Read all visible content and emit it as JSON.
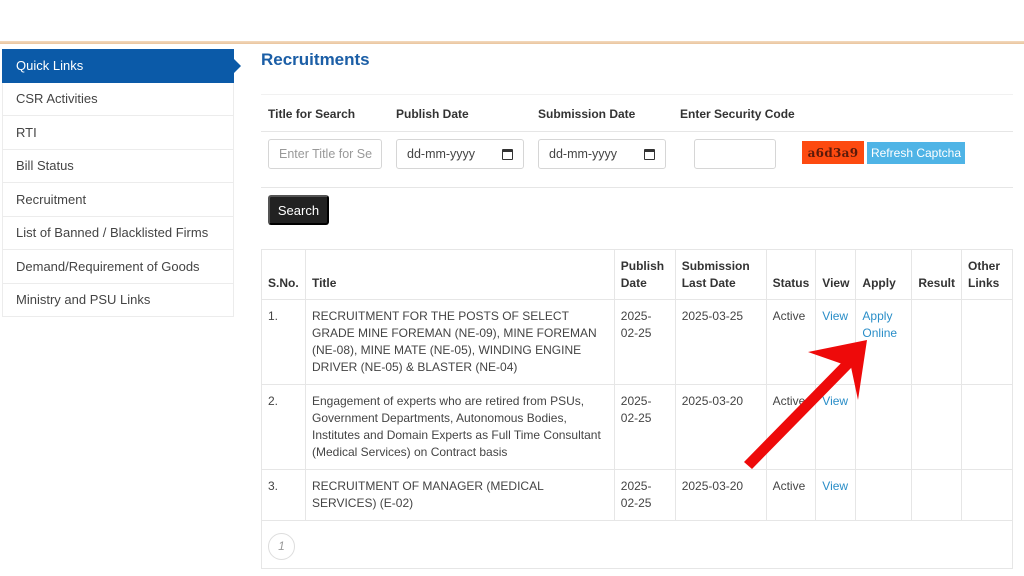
{
  "sidebar": {
    "items": [
      {
        "label": "Quick Links",
        "active": true
      },
      {
        "label": "CSR Activities"
      },
      {
        "label": "RTI"
      },
      {
        "label": "Bill Status"
      },
      {
        "label": "Recruitment"
      },
      {
        "label": "List of Banned / Blacklisted Firms"
      },
      {
        "label": "Demand/Requirement of Goods"
      },
      {
        "label": "Ministry and PSU Links"
      }
    ]
  },
  "page": {
    "title": "Recruitments"
  },
  "search_form": {
    "labels": {
      "title": "Title for Search",
      "publish_date": "Publish Date",
      "submission_date": "Submission Date",
      "security_code": "Enter Security Code"
    },
    "title_placeholder": "Enter Title for Se",
    "title_value": "",
    "publish_date_value": "dd-mm-yyyy",
    "submission_date_value": "dd-mm-yyyy",
    "security_code_value": "",
    "captcha_text": "a6d3a9",
    "refresh_label": "Refresh Captcha",
    "search_label": "Search",
    "colors": {
      "captcha_bg": "#fd4a10",
      "refresh_bg": "#4fb4e6",
      "search_bg": "#222222"
    }
  },
  "table": {
    "headers": {
      "sno": "S.No.",
      "title": "Title",
      "publish_1": "Publish",
      "publish_2": "Date",
      "submission_1": "Submission",
      "submission_2": "Last Date",
      "status": "Status",
      "view": "View",
      "apply": "Apply",
      "result": "Result",
      "other_1": "Other",
      "other_2": "Links"
    },
    "rows": [
      {
        "sno": "1.",
        "title": "RECRUITMENT FOR THE POSTS OF SELECT GRADE MINE FOREMAN (NE-09), MINE FOREMAN (NE-08), MINE MATE (NE-05), WINDING ENGINE DRIVER (NE-05) & BLASTER (NE-04)",
        "publish_1": "2025-",
        "publish_2": "02-25",
        "submission": "2025-03-25",
        "status": "Active",
        "view": "View",
        "apply_1": "Apply",
        "apply_2": "Online",
        "result": "",
        "other": ""
      },
      {
        "sno": "2.",
        "title": "Engagement of experts who are retired from PSUs, Government Departments, Autonomous Bodies, Institutes and Domain Experts as Full Time Consultant (Medical Services) on Contract basis",
        "publish_1": "2025-",
        "publish_2": "02-25",
        "submission": "2025-03-20",
        "status": "Active",
        "view": "View",
        "apply_1": "",
        "apply_2": "",
        "result": "",
        "other": ""
      },
      {
        "sno": "3.",
        "title": "RECRUITMENT OF MANAGER (MEDICAL SERVICES) (E-02)",
        "publish_1": "2025-",
        "publish_2": "02-25",
        "submission": "2025-03-20",
        "status": "Active",
        "view": "View",
        "apply_1": "",
        "apply_2": "",
        "result": "",
        "other": ""
      }
    ],
    "pagination": {
      "current_page": "1"
    }
  },
  "annotation": {
    "type": "red-arrow",
    "points_to": "Apply Online",
    "color": "#ee0a0a"
  },
  "theme": {
    "accent": "#0b5aa8",
    "title_color": "#1b5ea6",
    "link_color": "#2a8ec8"
  }
}
